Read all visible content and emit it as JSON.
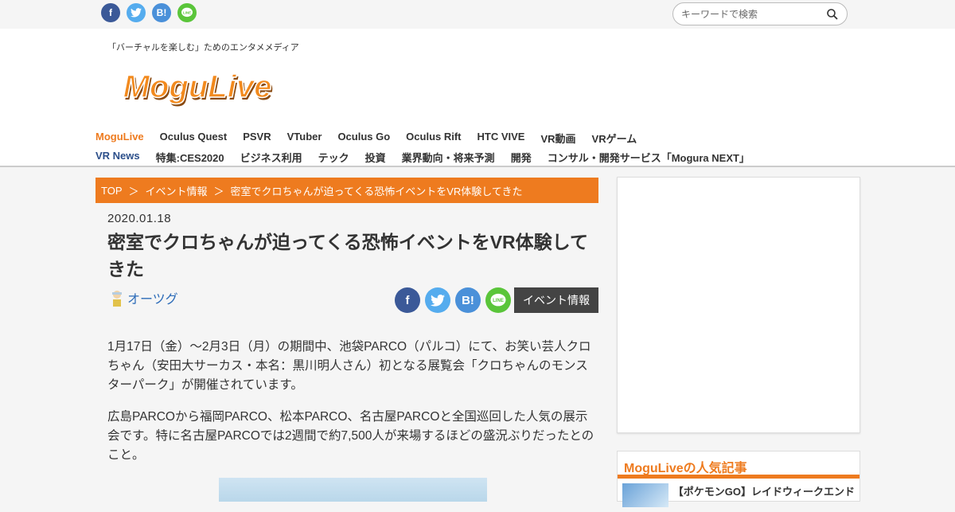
{
  "topbar": {
    "search_placeholder": "キーワードで検索"
  },
  "header": {
    "tagline": "「バーチャルを楽しむ」ためのエンタメメディア",
    "logo_text": "MoguLive"
  },
  "nav": {
    "row1": [
      "MoguLive",
      "Oculus Quest",
      "PSVR",
      "VTuber",
      "Oculus Go",
      "Oculus Rift",
      "HTC VIVE",
      "VR動画",
      "VRゲーム"
    ],
    "row2": [
      "VR News",
      "特集:CES2020",
      "ビジネス利用",
      "テック",
      "投資",
      "業界動向・将来予測",
      "開発",
      "コンサル・開発サービス「Mogura NEXT」"
    ]
  },
  "breadcrumb": {
    "items": [
      "TOP",
      "イベント情報",
      "密室でクロちゃんが迫ってくる恐怖イベントをVR体験してきた"
    ],
    "separator": "＞"
  },
  "article": {
    "date": "2020.01.18",
    "title": "密室でクロちゃんが迫ってくる恐怖イベントをVR体験してきた",
    "author": "オーツグ",
    "category": "イベント情報",
    "paragraphs": [
      "1月17日（金）～2月3日（月）の期間中、池袋PARCO（パルコ）にて、お笑い芸人クロちゃん（安田大サーカス・本名：黒川明人さん）初となる展覧会「クロちゃんのモンスターパーク」が開催されています。",
      "広島PARCOから福岡PARCO、松本PARCO、名古屋PARCOと全国巡回した人気の展示会です。特に名古屋PARCOでは2週間で約7,500人が来場するほどの盛況ぶりだったとのこと。"
    ]
  },
  "sidebar": {
    "popular_title": "MoguLiveの人気記事",
    "popular_items": [
      "【ポケモンGO】レイドウィークエンド"
    ]
  },
  "colors": {
    "accent": "#ee7b1f",
    "nav_blue": "#2c4f8a",
    "facebook": "#3b5998",
    "twitter": "#55acee",
    "hatena": "#4a90d9",
    "line": "#5ac53a"
  }
}
